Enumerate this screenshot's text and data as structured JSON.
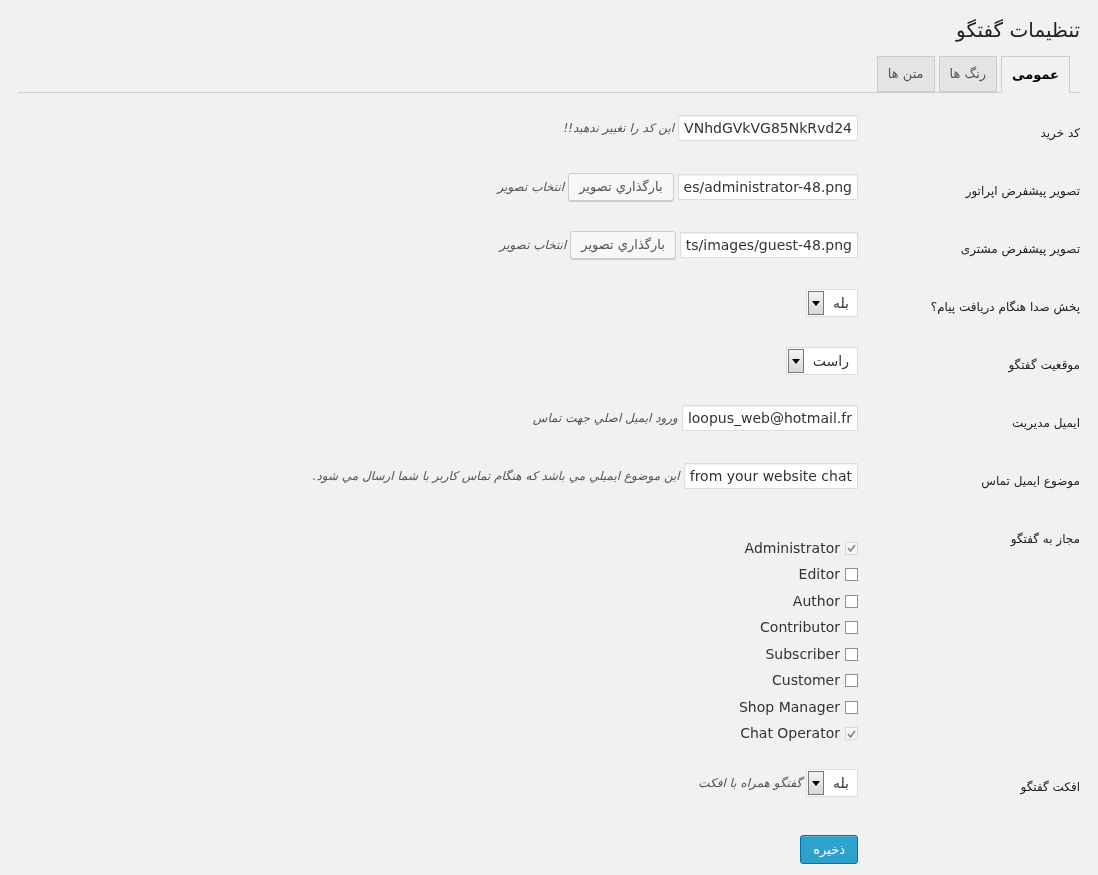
{
  "title": "تنظیمات گفتگو",
  "tabs": [
    {
      "label": "عمومی",
      "selected": true
    },
    {
      "label": "رنگ ها",
      "selected": false
    },
    {
      "label": "متن ها",
      "selected": false
    }
  ],
  "fields": [
    {
      "kind": "text",
      "label": "کد خرید",
      "value": "VNhdGVkVG85NkRvd24",
      "description": "این کد را تغییر ندهید!!"
    },
    {
      "kind": "image",
      "label": "تصویر پیشفرض اپراتور",
      "value": "es/administrator-48.png",
      "button": "بارگذاري تصویر",
      "description": "انتخاب تصویر"
    },
    {
      "kind": "image",
      "label": "تصویر پیشفرض مشتری",
      "value": "ts/images/guest-48.png",
      "button": "بارگذاري تصویر",
      "description": "انتخاب تصویر"
    },
    {
      "kind": "select",
      "label": "پخش صدا هنگام دریافت پیام؟",
      "value": "بله"
    },
    {
      "kind": "select",
      "label": "موقعیت گفتگو",
      "value": "راست"
    },
    {
      "kind": "text",
      "label": "ایمیل مدیریت",
      "value": "loopus_web@hotmail.fr",
      "description": "ورود ایمیل اصلي جهت تماس"
    },
    {
      "kind": "text",
      "label": "موضوع ایمیل تماس",
      "value": "from your website chat",
      "description": "این موضوع ایمیلي مي باشد که هنگام تماس کاربر با شما ارسال مي شود."
    },
    {
      "kind": "checkboxes",
      "label": "مجاز به گفتگو",
      "options": [
        {
          "label": "Administrator",
          "checked": true,
          "disabled": true
        },
        {
          "label": "Editor",
          "checked": false,
          "disabled": false
        },
        {
          "label": "Author",
          "checked": false,
          "disabled": false
        },
        {
          "label": "Contributor",
          "checked": false,
          "disabled": false
        },
        {
          "label": "Subscriber",
          "checked": false,
          "disabled": false
        },
        {
          "label": "Customer",
          "checked": false,
          "disabled": false
        },
        {
          "label": "Shop Manager",
          "checked": false,
          "disabled": false
        },
        {
          "label": "Chat Operator",
          "checked": true,
          "disabled": true
        }
      ]
    },
    {
      "kind": "select",
      "label": "افکت گفتگو",
      "value": "بله",
      "description": "گفتگو همراه با افکت"
    }
  ],
  "save_button": "ذخیره"
}
